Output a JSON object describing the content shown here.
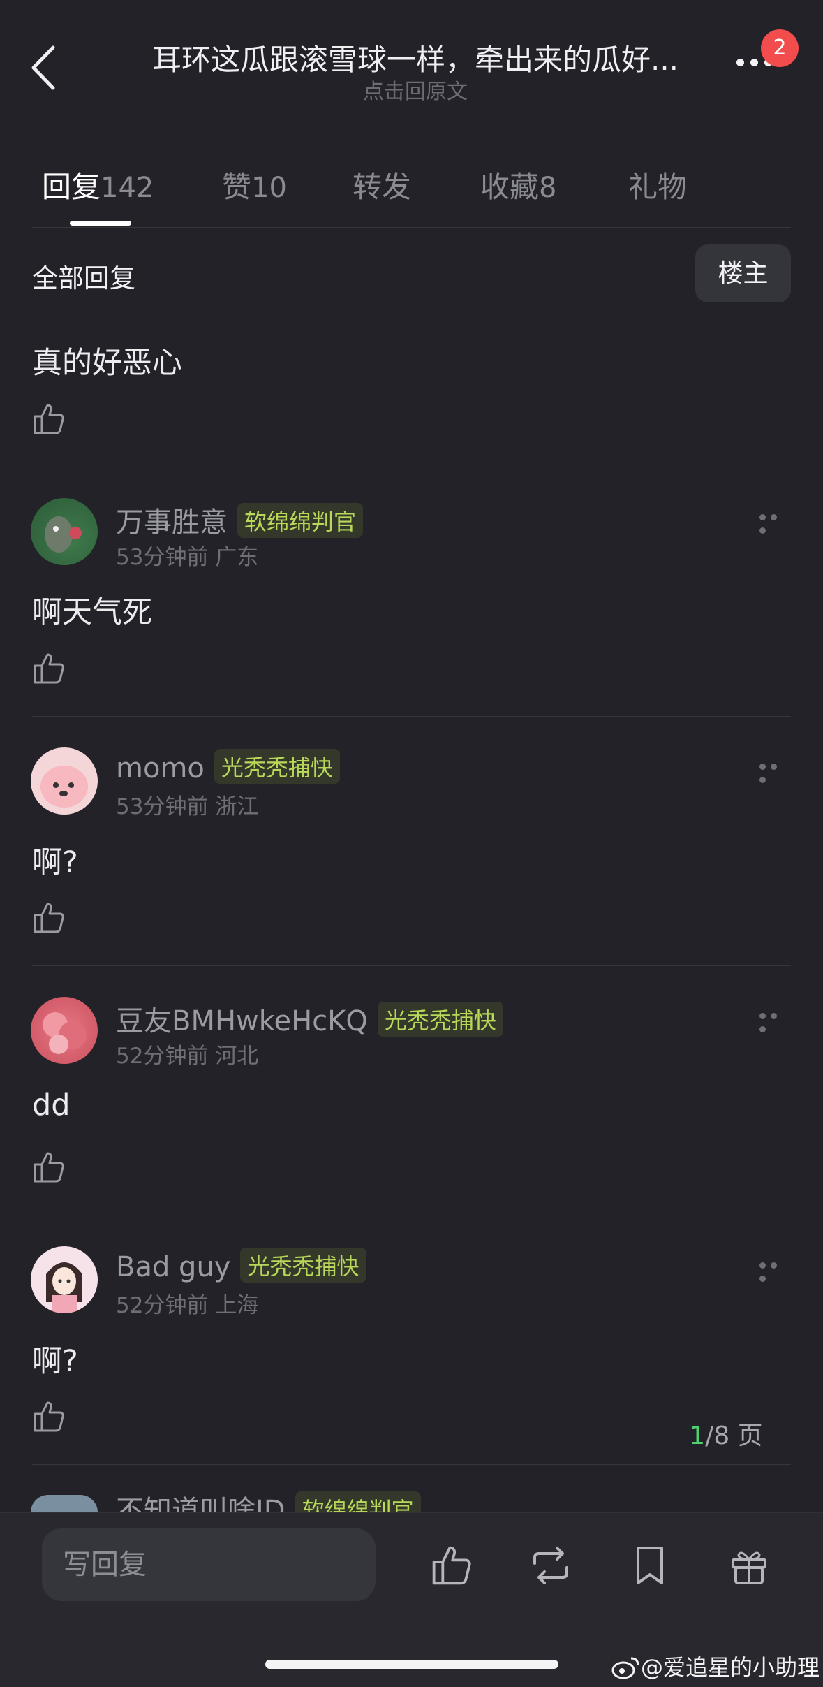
{
  "header": {
    "title": "耳环这瓜跟滚雪球一样，牵出来的瓜好...",
    "subtitle": "点击回原文",
    "notification_count": "2"
  },
  "tabs": [
    {
      "label": "回复",
      "count": "142",
      "active": true
    },
    {
      "label": "赞",
      "count": "10"
    },
    {
      "label": "转发",
      "count": ""
    },
    {
      "label": "收藏",
      "count": "8"
    },
    {
      "label": "礼物",
      "count": ""
    }
  ],
  "filter": {
    "label": "全部回复",
    "owner_button": "楼主"
  },
  "first_comment": {
    "text": "真的好恶心"
  },
  "comments": [
    {
      "user": "万事胜意",
      "tag": "软绵绵判官",
      "time": "53分钟前",
      "location": "广东",
      "text": "啊天气死"
    },
    {
      "user": "momo",
      "tag": "光秃秃捕快",
      "time": "53分钟前",
      "location": "浙江",
      "text": "啊?"
    },
    {
      "user": "豆友BMHwkeHcKQ",
      "tag": "光秃秃捕快",
      "time": "52分钟前",
      "location": "河北",
      "text": "dd"
    },
    {
      "user": "Bad guy",
      "tag": "光秃秃捕快",
      "time": "52分钟前",
      "location": "上海",
      "text": "啊?"
    }
  ],
  "partial_comment": {
    "user": "不知道叫啥ID",
    "tag": "软绵绵判官"
  },
  "pagination": {
    "current": "1",
    "total_text": "/8 页"
  },
  "bottom": {
    "reply_placeholder": "写回复"
  },
  "watermark": "@爱追星的小助理",
  "colors": {
    "background": "#222228",
    "tag_text": "#b9d85a",
    "badge": "#f24c4c",
    "page_current": "#4cd16e"
  }
}
